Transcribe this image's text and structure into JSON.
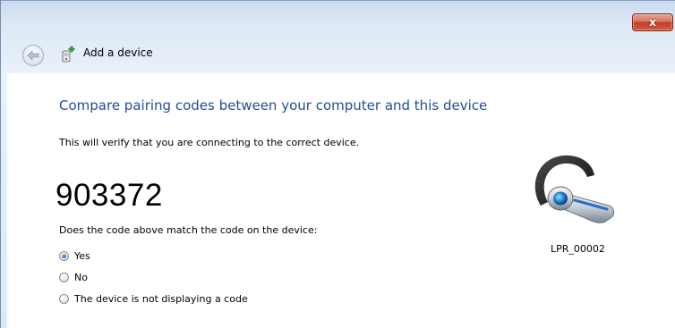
{
  "window": {
    "title": "Add a device",
    "close_label": "x"
  },
  "nav": {
    "back_icon": "back-arrow-icon",
    "wizard_icon": "add-device-icon"
  },
  "main": {
    "heading": "Compare pairing codes between your computer and this device",
    "intro": "This will verify that you are connecting to the correct device.",
    "code": "903372",
    "question": "Does the code above match the code on the device:",
    "options": [
      {
        "label": "Yes",
        "checked": true
      },
      {
        "label": "No",
        "checked": false
      },
      {
        "label": "The device is not displaying a code",
        "checked": false
      }
    ]
  },
  "device": {
    "name": "LPR_00002",
    "icon": "headset-icon"
  },
  "colors": {
    "heading": "#1f4e9a",
    "close_button": "#c0402a"
  }
}
